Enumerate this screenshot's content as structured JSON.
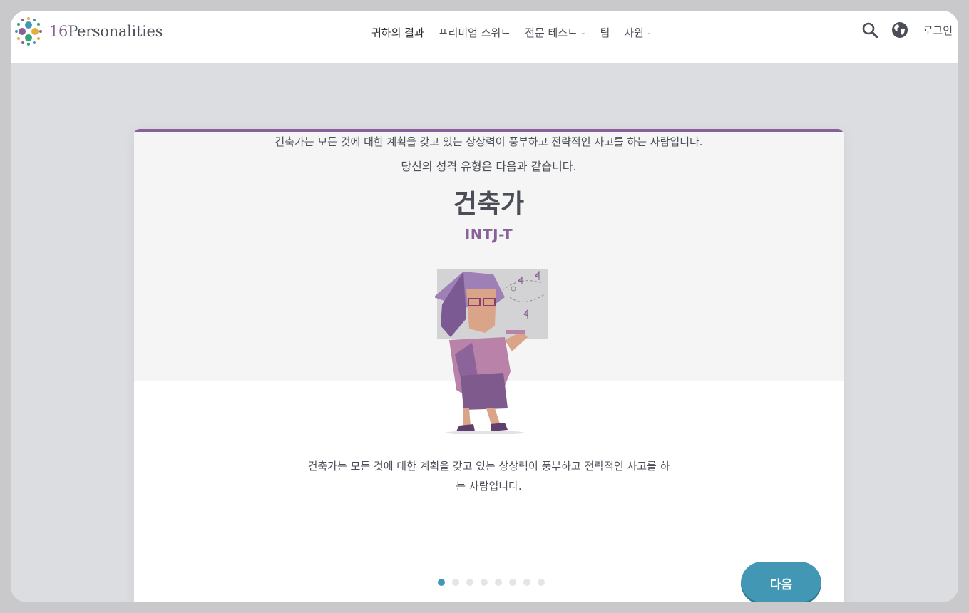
{
  "brand": {
    "logo_text": "Personalities",
    "logo_number": "16"
  },
  "nav": {
    "items": [
      {
        "label": "귀하의 결과",
        "active": true,
        "has_dropdown": false
      },
      {
        "label": "프리미엄 스위트",
        "active": false,
        "has_dropdown": false
      },
      {
        "label": "전문 테스트",
        "active": false,
        "has_dropdown": true
      },
      {
        "label": "팀",
        "active": false,
        "has_dropdown": false
      },
      {
        "label": "자원",
        "active": false,
        "has_dropdown": true
      }
    ],
    "dropdown_icon": "chevron-down-icon"
  },
  "tools": {
    "search_icon": "search-icon",
    "language_icon": "globe-icon",
    "login_label": "로그인"
  },
  "result": {
    "intro_line_1": "건축가는 모든 것에 대한 계획을 갖고 있는 상상력이 풍부하고 전략적인 사고를 하는 사람입니다.",
    "intro_line_2": "당신의 성격 유형은 다음과 같습니다.",
    "type_name": "건축가",
    "type_code": "INTJ-T",
    "description": "건축가는 모든 것에 대한 계획을 갖고 있는 상상력이 풍부하고 전략적인 사고를 하는 사람입니다."
  },
  "pager": {
    "total": 8,
    "current": 1
  },
  "next_label": "다음",
  "colors": {
    "accent": "#4298b4",
    "analyst_purple": "#88619a",
    "text": "#4b4e57"
  }
}
